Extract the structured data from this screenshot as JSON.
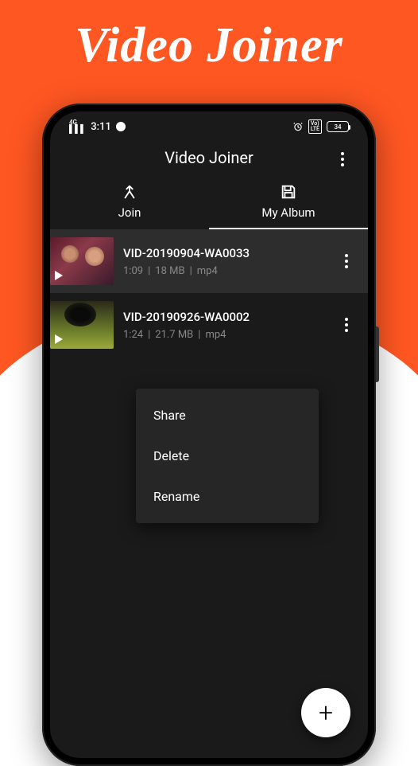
{
  "promo": {
    "title": "Video Joiner"
  },
  "status": {
    "network_label": "4G",
    "time": "3:11",
    "lte_label": "Vo)\nLTE",
    "battery": "34"
  },
  "header": {
    "title": "Video Joiner"
  },
  "tabs": {
    "join": "Join",
    "my_album": "My Album"
  },
  "videos": [
    {
      "title": "VID-20190904-WA0033",
      "duration": "1:09",
      "size": "18 MB",
      "format": "mp4"
    },
    {
      "title": "VID-20190926-WA0002",
      "duration": "1:24",
      "size": "21.7 MB",
      "format": "mp4"
    }
  ],
  "menu": {
    "share": "Share",
    "delete": "Delete",
    "rename": "Rename"
  },
  "meta_sep": "|"
}
